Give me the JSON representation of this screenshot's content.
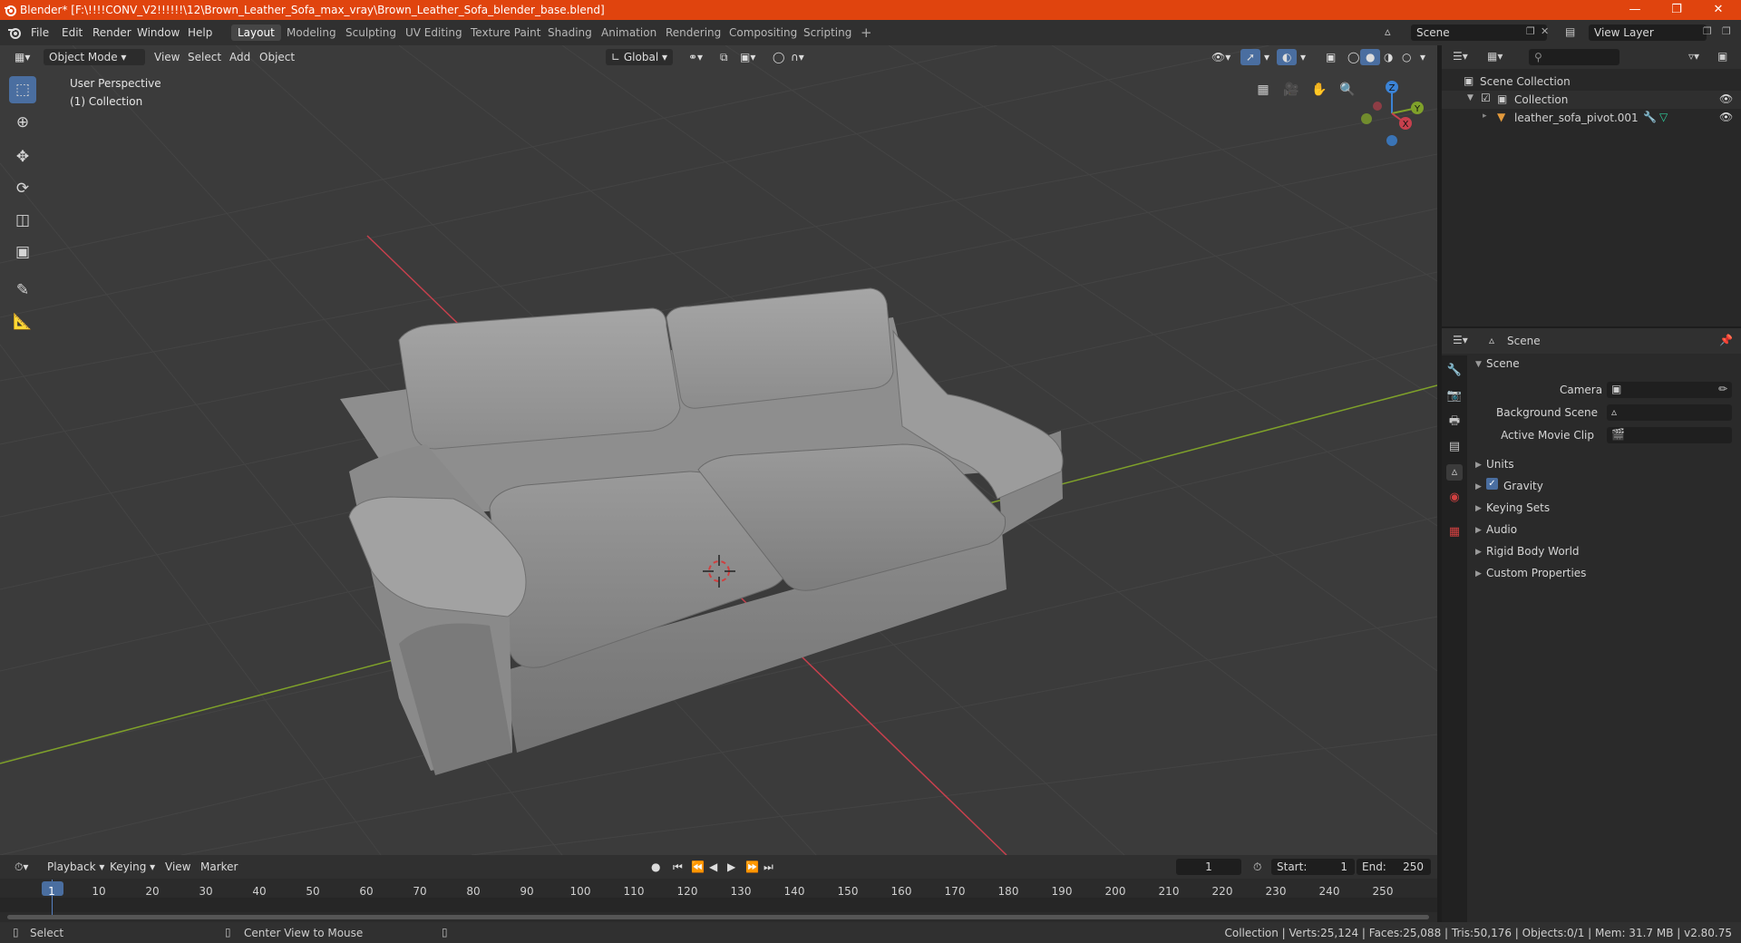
{
  "window": {
    "title": "Blender* [F:\\!!!!CONV_V2!!!!!!\\12\\Brown_Leather_Sofa_max_vray\\Brown_Leather_Sofa_blender_base.blend]"
  },
  "menu": [
    "File",
    "Edit",
    "Render",
    "Window",
    "Help"
  ],
  "workspaces": [
    "Layout",
    "Modeling",
    "Sculpting",
    "UV Editing",
    "Texture Paint",
    "Shading",
    "Animation",
    "Rendering",
    "Compositing",
    "Scripting"
  ],
  "active_workspace": "Layout",
  "scene_selector": "Scene",
  "view_layer_selector": "View Layer",
  "viewport_header": {
    "mode": "Object Mode",
    "menus": [
      "View",
      "Select",
      "Add",
      "Object"
    ],
    "orientation": "Global"
  },
  "viewport_overlay": {
    "view_name": "User Perspective",
    "collection": "(1) Collection"
  },
  "gizmo_axes": {
    "z": "Z",
    "y": "Y",
    "x": "X"
  },
  "outliner": {
    "root": "Scene Collection",
    "collection": "Collection",
    "object": "leather_sofa_pivot.001"
  },
  "properties": {
    "header": "Scene",
    "section": "Scene",
    "fields": [
      {
        "label": "Camera"
      },
      {
        "label": "Background Scene"
      },
      {
        "label": "Active Movie Clip"
      }
    ],
    "panels": [
      "Units",
      "Gravity",
      "Keying Sets",
      "Audio",
      "Rigid Body World",
      "Custom Properties"
    ],
    "gravity_checked": true
  },
  "timeline": {
    "menus": [
      "Playback",
      "Keying",
      "View",
      "Marker"
    ],
    "current_frame": "1",
    "start_label": "Start:",
    "start": "1",
    "end_label": "End:",
    "end": "250",
    "ticks": [
      "1",
      "10",
      "20",
      "30",
      "40",
      "50",
      "60",
      "70",
      "80",
      "90",
      "100",
      "110",
      "120",
      "130",
      "140",
      "150",
      "160",
      "170",
      "180",
      "190",
      "200",
      "210",
      "220",
      "230",
      "240",
      "250"
    ]
  },
  "statusbar": {
    "left": "Select",
    "middle": "Center View to Mouse",
    "right": "Collection | Verts:25,124 | Faces:25,088 | Tris:50,176 | Objects:0/1 | Mem: 31.7 MB | v2.80.75"
  },
  "colors": {
    "titlebar": "#e0440e",
    "viewport_bg": "#3b3b3b",
    "x_axis": "#c7404d",
    "y_axis": "#7fa12a",
    "z_axis": "#3b83d6",
    "active_tool": "#4a6ea0"
  }
}
